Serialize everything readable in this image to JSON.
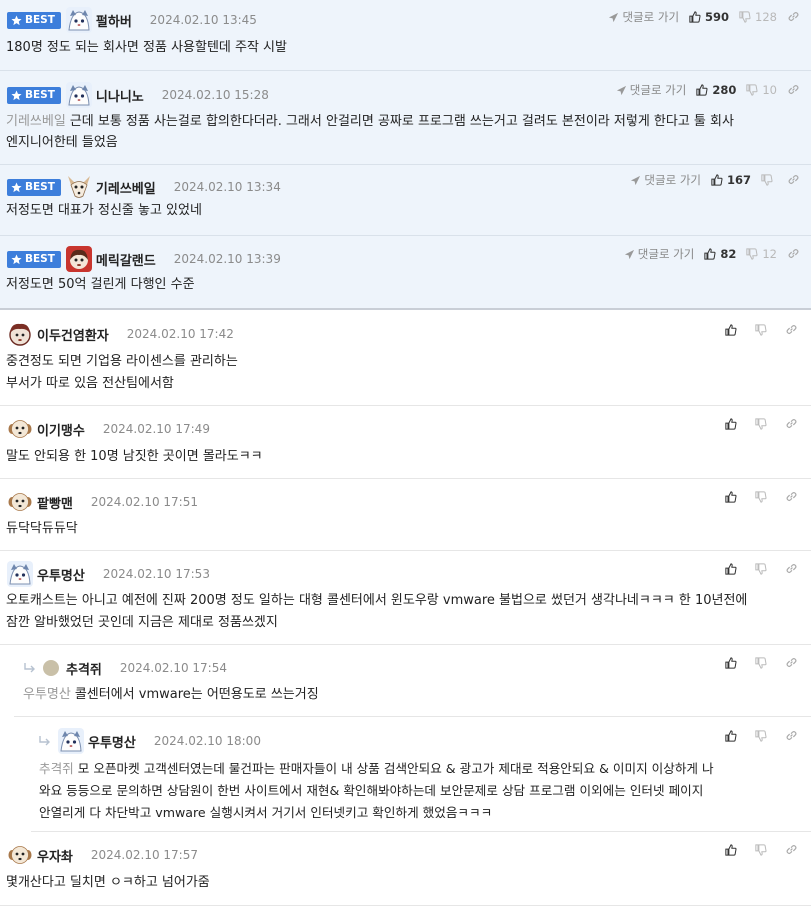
{
  "labels": {
    "best": "BEST",
    "reply_to": "댓글로 가기"
  },
  "comments": [
    {
      "nick": "펄하버",
      "date": "2024.02.10 13:45",
      "up": "590",
      "down": "128",
      "mention": "",
      "text": "180명 정도 되는 회사면 정품 사용할텐데 주작 시발"
    },
    {
      "nick": "니나니노",
      "date": "2024.02.10 15:28",
      "up": "280",
      "down": "10",
      "mention": "기레쓰베일",
      "text": "근데 보통 정품 사는걸로 합의한다더라. 그래서 안걸리면 공짜로 프로그램 쓰는거고 걸려도 본전이라 저렇게 한다고 툴 회사\n엔지니어한테 들었음"
    },
    {
      "nick": "기레쓰베일",
      "date": "2024.02.10 13:34",
      "up": "167",
      "down": "",
      "mention": "",
      "text": "저정도면 대표가 정신줄 놓고 있었네"
    },
    {
      "nick": "메릭갈랜드",
      "date": "2024.02.10 13:39",
      "up": "82",
      "down": "12",
      "mention": "",
      "text": "저정도면 50억 걸린게 다행인 수준"
    },
    {
      "nick": "이두건염환자",
      "date": "2024.02.10 17:42",
      "mention": "",
      "text": "중견정도 되면 기업용 라이센스를 관리하는\n부서가 따로 있음 전산팀에서함"
    },
    {
      "nick": "이기맹수",
      "date": "2024.02.10 17:49",
      "mention": "",
      "text": "말도 안되용 한 10명 남짓한 곳이면 몰라도ㅋㅋ"
    },
    {
      "nick": "팥빵맨",
      "date": "2024.02.10 17:51",
      "mention": "",
      "text": "듀닥닥듀듀닥"
    },
    {
      "nick": "우투명산",
      "date": "2024.02.10 17:53",
      "mention": "",
      "text": "오토캐스트는 아니고 예전에 진짜 200명 정도 일하는 대형 콜센터에서 윈도우랑 vmware 불법으로 썼던거 생각나네ㅋㅋㅋ 한 10년전에\n잠깐 알바했었던 곳인데 지금은 제대로 정품쓰겠지"
    },
    {
      "nick": "추격쥐",
      "date": "2024.02.10 17:54",
      "mention": "우투명산",
      "text": "콜센터에서 vmware는 어떤용도로 쓰는거징"
    },
    {
      "nick": "우투명산",
      "date": "2024.02.10 18:00",
      "mention": "추격쥐",
      "text": "모 오픈마켓 고객센터였는데 물건파는 판매자들이 내 상품 검색안되요 & 광고가 제대로 적용안되요 & 이미지 이상하게 나\n와요 등등으로 문의하면 상담원이 한번 사이트에서 재현& 확인해봐야하는데 보안문제로 상담 프로그램 이외에는 인터넷 페이지\n안열리게 다 차단박고 vmware 실행시켜서 거기서 인터넷키고 확인하게 했었음ㅋㅋㅋ"
    },
    {
      "nick": "우자촤",
      "date": "2024.02.10 17:57",
      "mention": "",
      "text": "몇개산다고 딜치면 ㅇㅋ하고 넘어가줌"
    }
  ],
  "icons": {
    "star": "star-icon",
    "reply_arrow": "paper-plane-icon",
    "upvote": "thumbs-up-icon",
    "downvote": "thumbs-down-icon",
    "share": "link-icon",
    "nested": "reply-arrow-icon"
  },
  "colors": {
    "best_bg": "#eef4fb",
    "badge": "#3d7edb",
    "meta": "#8b8b8b"
  }
}
